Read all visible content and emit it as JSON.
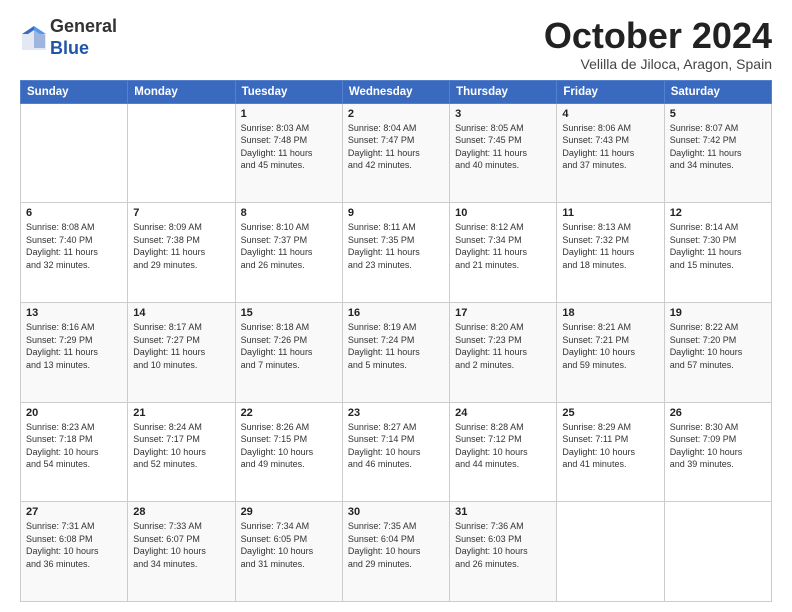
{
  "logo": {
    "general": "General",
    "blue": "Blue"
  },
  "header": {
    "month": "October 2024",
    "location": "Velilla de Jiloca, Aragon, Spain"
  },
  "weekdays": [
    "Sunday",
    "Monday",
    "Tuesday",
    "Wednesday",
    "Thursday",
    "Friday",
    "Saturday"
  ],
  "weeks": [
    [
      {
        "day": "",
        "info": ""
      },
      {
        "day": "",
        "info": ""
      },
      {
        "day": "1",
        "info": "Sunrise: 8:03 AM\nSunset: 7:48 PM\nDaylight: 11 hours\nand 45 minutes."
      },
      {
        "day": "2",
        "info": "Sunrise: 8:04 AM\nSunset: 7:47 PM\nDaylight: 11 hours\nand 42 minutes."
      },
      {
        "day": "3",
        "info": "Sunrise: 8:05 AM\nSunset: 7:45 PM\nDaylight: 11 hours\nand 40 minutes."
      },
      {
        "day": "4",
        "info": "Sunrise: 8:06 AM\nSunset: 7:43 PM\nDaylight: 11 hours\nand 37 minutes."
      },
      {
        "day": "5",
        "info": "Sunrise: 8:07 AM\nSunset: 7:42 PM\nDaylight: 11 hours\nand 34 minutes."
      }
    ],
    [
      {
        "day": "6",
        "info": "Sunrise: 8:08 AM\nSunset: 7:40 PM\nDaylight: 11 hours\nand 32 minutes."
      },
      {
        "day": "7",
        "info": "Sunrise: 8:09 AM\nSunset: 7:38 PM\nDaylight: 11 hours\nand 29 minutes."
      },
      {
        "day": "8",
        "info": "Sunrise: 8:10 AM\nSunset: 7:37 PM\nDaylight: 11 hours\nand 26 minutes."
      },
      {
        "day": "9",
        "info": "Sunrise: 8:11 AM\nSunset: 7:35 PM\nDaylight: 11 hours\nand 23 minutes."
      },
      {
        "day": "10",
        "info": "Sunrise: 8:12 AM\nSunset: 7:34 PM\nDaylight: 11 hours\nand 21 minutes."
      },
      {
        "day": "11",
        "info": "Sunrise: 8:13 AM\nSunset: 7:32 PM\nDaylight: 11 hours\nand 18 minutes."
      },
      {
        "day": "12",
        "info": "Sunrise: 8:14 AM\nSunset: 7:30 PM\nDaylight: 11 hours\nand 15 minutes."
      }
    ],
    [
      {
        "day": "13",
        "info": "Sunrise: 8:16 AM\nSunset: 7:29 PM\nDaylight: 11 hours\nand 13 minutes."
      },
      {
        "day": "14",
        "info": "Sunrise: 8:17 AM\nSunset: 7:27 PM\nDaylight: 11 hours\nand 10 minutes."
      },
      {
        "day": "15",
        "info": "Sunrise: 8:18 AM\nSunset: 7:26 PM\nDaylight: 11 hours\nand 7 minutes."
      },
      {
        "day": "16",
        "info": "Sunrise: 8:19 AM\nSunset: 7:24 PM\nDaylight: 11 hours\nand 5 minutes."
      },
      {
        "day": "17",
        "info": "Sunrise: 8:20 AM\nSunset: 7:23 PM\nDaylight: 11 hours\nand 2 minutes."
      },
      {
        "day": "18",
        "info": "Sunrise: 8:21 AM\nSunset: 7:21 PM\nDaylight: 10 hours\nand 59 minutes."
      },
      {
        "day": "19",
        "info": "Sunrise: 8:22 AM\nSunset: 7:20 PM\nDaylight: 10 hours\nand 57 minutes."
      }
    ],
    [
      {
        "day": "20",
        "info": "Sunrise: 8:23 AM\nSunset: 7:18 PM\nDaylight: 10 hours\nand 54 minutes."
      },
      {
        "day": "21",
        "info": "Sunrise: 8:24 AM\nSunset: 7:17 PM\nDaylight: 10 hours\nand 52 minutes."
      },
      {
        "day": "22",
        "info": "Sunrise: 8:26 AM\nSunset: 7:15 PM\nDaylight: 10 hours\nand 49 minutes."
      },
      {
        "day": "23",
        "info": "Sunrise: 8:27 AM\nSunset: 7:14 PM\nDaylight: 10 hours\nand 46 minutes."
      },
      {
        "day": "24",
        "info": "Sunrise: 8:28 AM\nSunset: 7:12 PM\nDaylight: 10 hours\nand 44 minutes."
      },
      {
        "day": "25",
        "info": "Sunrise: 8:29 AM\nSunset: 7:11 PM\nDaylight: 10 hours\nand 41 minutes."
      },
      {
        "day": "26",
        "info": "Sunrise: 8:30 AM\nSunset: 7:09 PM\nDaylight: 10 hours\nand 39 minutes."
      }
    ],
    [
      {
        "day": "27",
        "info": "Sunrise: 7:31 AM\nSunset: 6:08 PM\nDaylight: 10 hours\nand 36 minutes."
      },
      {
        "day": "28",
        "info": "Sunrise: 7:33 AM\nSunset: 6:07 PM\nDaylight: 10 hours\nand 34 minutes."
      },
      {
        "day": "29",
        "info": "Sunrise: 7:34 AM\nSunset: 6:05 PM\nDaylight: 10 hours\nand 31 minutes."
      },
      {
        "day": "30",
        "info": "Sunrise: 7:35 AM\nSunset: 6:04 PM\nDaylight: 10 hours\nand 29 minutes."
      },
      {
        "day": "31",
        "info": "Sunrise: 7:36 AM\nSunset: 6:03 PM\nDaylight: 10 hours\nand 26 minutes."
      },
      {
        "day": "",
        "info": ""
      },
      {
        "day": "",
        "info": ""
      }
    ]
  ]
}
